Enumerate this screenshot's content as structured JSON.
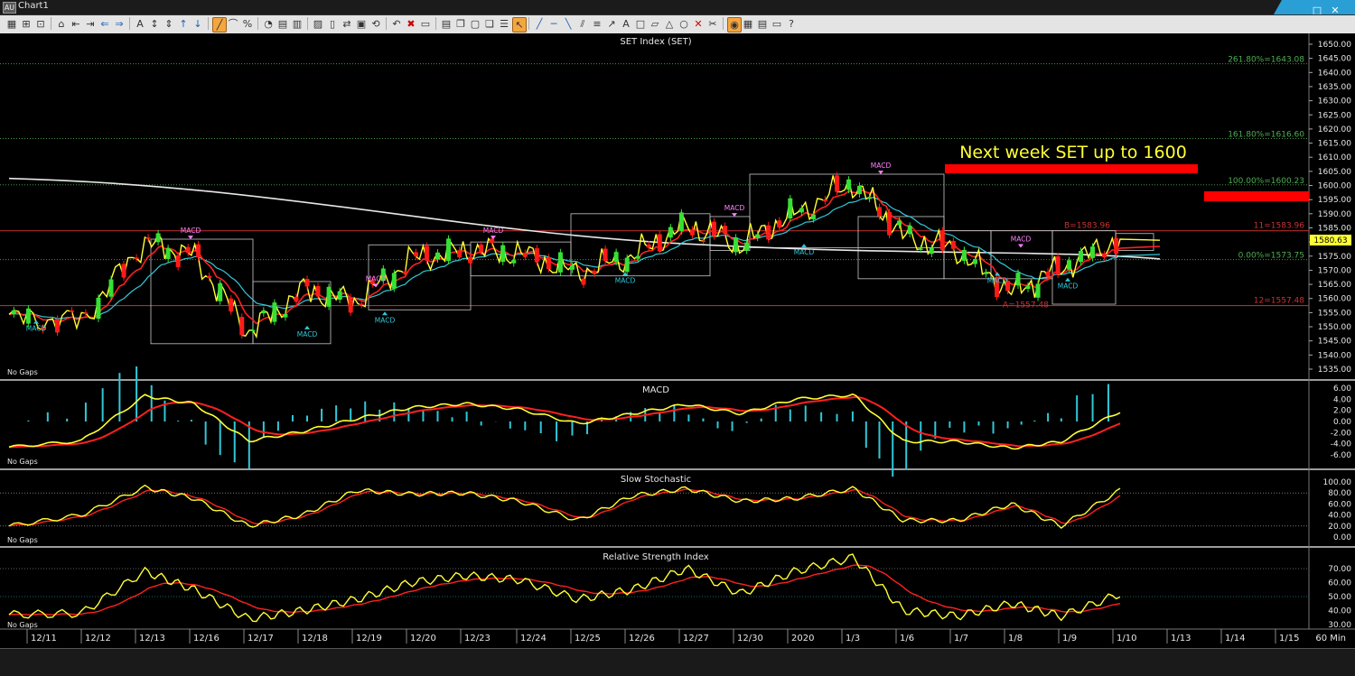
{
  "window": {
    "title": "Chart1",
    "app_icon_label": "AU",
    "buttons": [
      "▁",
      "□",
      "✕"
    ]
  },
  "toolbar": {
    "icons": [
      "select-icon",
      "zoom-in-icon",
      "zoom-fit-icon",
      "home-icon",
      "h-scroll-left-icon",
      "h-scroll-right-icon",
      "scroll-left-icon",
      "scroll-right-icon",
      "text-scale-icon",
      "v-scale-icon",
      "v-expand-icon",
      "up-icon",
      "down-icon",
      "draw-line-icon",
      "curve-icon",
      "percent-icon",
      "indicator-icon",
      "template-icon",
      "chart-type-icon",
      "studies-icon",
      "bar-icon",
      "compare-icon",
      "layout-icon",
      "sync-icon",
      "undo-chart-icon",
      "delete-icon",
      "save-icon",
      "print-icon",
      "copy-icon",
      "paste-icon",
      "clone-icon",
      "properties-icon",
      "cursor-icon",
      "line-tool-icon",
      "ray-icon",
      "trend-icon",
      "channel-icon",
      "fib-icon",
      "arrow-icon",
      "text-tool-icon",
      "rect-icon",
      "callout-icon",
      "triangle-icon",
      "ellipse-icon",
      "cross-icon",
      "delete-drawing-icon",
      "magnet-icon",
      "grid-icon",
      "table-icon",
      "window-icon",
      "help-icon"
    ]
  },
  "colors": {
    "up_candle": "#35e035",
    "down_candle": "#ff1a1a",
    "price_line": "#ffff33",
    "sma_fast": "#ff2020",
    "sma_slow": "#31c8d8",
    "sma_long": "#e8e8e8",
    "fib_line": "#4caf50",
    "support_line": "#c83232",
    "annotation": "#ffff33",
    "banner": "#ff0000",
    "macd_label": "#ff80ff",
    "macd_buy": "#31c8d8"
  },
  "price_panel": {
    "title": "SET Index (SET)",
    "no_gaps": "No Gaps",
    "last_price": "1580.63",
    "annotation": "Next week SET up to 1600",
    "fib_labels": {
      "f2618": "261.80%=1643.08",
      "f1618": "161.80%=1616.60",
      "f100": "100.00%=1600.23",
      "f0": "0.00%=1573.75"
    },
    "fib_values": {
      "f2618": 1643.08,
      "f1618": 1616.6,
      "f100": 1600.23,
      "f0": 1573.75
    },
    "hline_labels": {
      "r11": "11=1583.96",
      "r12": "12=1557.48",
      "b": "B=1583.96",
      "a": "A=1557.48"
    },
    "hline_values": {
      "r11": 1583.96,
      "r12": 1557.48
    },
    "signal_text": "MACD",
    "y_ticks": [
      "1650.00",
      "1645.00",
      "1640.00",
      "1635.00",
      "1630.00",
      "1625.00",
      "1620.00",
      "1615.00",
      "1610.00",
      "1605.00",
      "1600.00",
      "1595.00",
      "1590.00",
      "1585.00",
      "1580.00",
      "1575.00",
      "1570.00",
      "1565.00",
      "1560.00",
      "1555.00",
      "1550.00",
      "1545.00",
      "1540.00",
      "1535.00"
    ]
  },
  "macd_panel": {
    "title": "MACD",
    "no_gaps": "No Gaps",
    "y_ticks": [
      "6.00",
      "4.00",
      "2.00",
      "0.00",
      "-2.00",
      "-4.00",
      "-6.00"
    ]
  },
  "stoch_panel": {
    "title": "Slow Stochastic",
    "no_gaps": "No Gaps",
    "y_ticks": [
      "100.00",
      "80.00",
      "60.00",
      "40.00",
      "20.00",
      "0.00"
    ]
  },
  "rsi_panel": {
    "title": "Relative Strength Index",
    "no_gaps": "No Gaps",
    "y_ticks": [
      "70.00",
      "60.00",
      "50.00",
      "40.00",
      "30.00"
    ]
  },
  "x_axis": {
    "labels": [
      "12/11",
      "12/12",
      "12/13",
      "12/16",
      "12/17",
      "12/18",
      "12/19",
      "12/20",
      "12/23",
      "12/24",
      "12/25",
      "12/26",
      "12/27",
      "12/30",
      "2020",
      "1/3",
      "1/6",
      "1/7",
      "1/8",
      "1/9",
      "1/10",
      "1/13",
      "1/14",
      "1/15"
    ],
    "interval": "60 Min"
  },
  "chart_data": [
    {
      "type": "line",
      "name": "price",
      "title": "SET Index (SET)",
      "x": [
        "12/11",
        "12/12",
        "12/13",
        "12/16",
        "12/17",
        "12/18",
        "12/19",
        "12/20",
        "12/23",
        "12/24",
        "12/25",
        "12/26",
        "12/27",
        "12/30",
        "2020",
        "1/3",
        "1/6",
        "1/7",
        "1/8",
        "1/9",
        "1/10"
      ],
      "series": [
        {
          "values": [
            1553,
            1552,
            1580,
            1575,
            1548,
            1563,
            1559,
            1574,
            1577,
            1576,
            1569,
            1575,
            1586,
            1579,
            1590,
            1601,
            1582,
            1577,
            1562,
            1571,
            1581
          ]
        }
      ],
      "ylim": [
        1532,
        1652
      ],
      "last": 1580.63
    },
    {
      "type": "line",
      "name": "macd",
      "title": "MACD",
      "ylim": [
        -7,
        7
      ],
      "series": [
        {
          "values": [
            -4.6,
            -3.5,
            4.6,
            3.2,
            -3.5,
            -1.8,
            0.5,
            2.5,
            3.2,
            2.2,
            -0.4,
            1.4,
            3.1,
            1.4,
            4,
            4.8,
            -3.6,
            -3.6,
            -4.8,
            -3.6,
            1.8
          ]
        }
      ]
    },
    {
      "type": "line",
      "name": "slow_stochastic",
      "title": "Slow Stochastic",
      "ylim": [
        0,
        100
      ],
      "series": [
        {
          "values": [
            20,
            40,
            90,
            70,
            20,
            40,
            85,
            78,
            80,
            65,
            30,
            75,
            88,
            65,
            70,
            88,
            30,
            30,
            60,
            20,
            85
          ]
        }
      ]
    },
    {
      "type": "line",
      "name": "rsi",
      "title": "Relative Strength Index",
      "ylim": [
        27,
        74
      ],
      "series": [
        {
          "values": [
            37,
            38,
            68,
            55,
            34,
            40,
            48,
            60,
            65,
            62,
            48,
            55,
            70,
            52,
            68,
            78,
            40,
            36,
            45,
            36,
            52
          ]
        }
      ]
    }
  ]
}
